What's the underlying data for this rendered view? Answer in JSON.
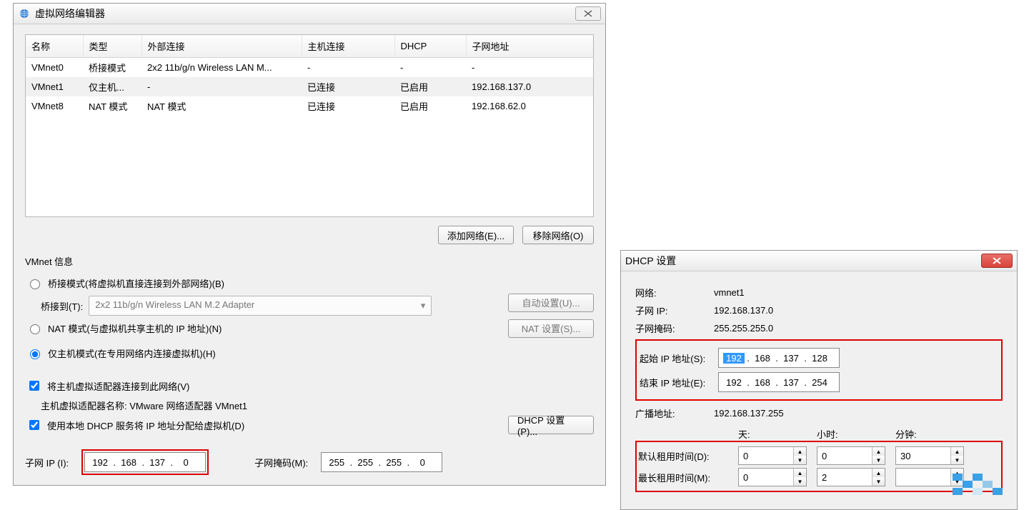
{
  "vnet_window": {
    "title": "虚拟网络编辑器",
    "table": {
      "headers": {
        "name": "名称",
        "type": "类型",
        "external": "外部连接",
        "host": "主机连接",
        "dhcp": "DHCP",
        "subnet": "子网地址"
      },
      "rows": [
        {
          "name": "VMnet0",
          "type": "桥接模式",
          "external": "2x2 11b/g/n Wireless LAN M...",
          "host": "-",
          "dhcp": "-",
          "subnet": "-",
          "selected": false
        },
        {
          "name": "VMnet1",
          "type": "仅主机...",
          "external": "-",
          "host": "已连接",
          "dhcp": "已启用",
          "subnet": "192.168.137.0",
          "selected": true
        },
        {
          "name": "VMnet8",
          "type": "NAT 模式",
          "external": "NAT 模式",
          "host": "已连接",
          "dhcp": "已启用",
          "subnet": "192.168.62.0",
          "selected": false
        }
      ]
    },
    "buttons": {
      "add": "添加网络(E)...",
      "remove": "移除网络(O)",
      "auto": "自动设置(U)...",
      "nat": "NAT 设置(S)...",
      "dhcp": "DHCP 设置(P)..."
    },
    "info_label": "VMnet 信息",
    "radios": {
      "bridge": "桥接模式(将虚拟机直接连接到外部网络)(B)",
      "bridge_to_label": "桥接到(T):",
      "bridge_to_value": "2x2 11b/g/n Wireless LAN M.2 Adapter",
      "nat": "NAT 模式(与虚拟机共享主机的 IP 地址)(N)",
      "hostonly": "仅主机模式(在专用网络内连接虚拟机)(H)"
    },
    "checks": {
      "connect_host": "将主机虚拟适配器连接到此网络(V)",
      "adapter_name": "主机虚拟适配器名称: VMware 网络适配器 VMnet1",
      "use_dhcp": "使用本地 DHCP 服务将 IP 地址分配给虚拟机(D)"
    },
    "subnet_row": {
      "ip_label": "子网 IP (I):",
      "ip_oct": [
        "192",
        "168",
        "137",
        "0"
      ],
      "mask_label": "子网掩码(M):",
      "mask_oct": [
        "255",
        "255",
        "255",
        "0"
      ]
    }
  },
  "dhcp_window": {
    "title": "DHCP 设置",
    "labels": {
      "network": "网络:",
      "subnet_ip": "子网 IP:",
      "subnet_mask": "子网掩码:",
      "start_ip": "起始 IP 地址(S):",
      "end_ip": "结束 IP 地址(E):",
      "broadcast": "广播地址:",
      "days": "天:",
      "hours": "小时:",
      "minutes": "分钟:",
      "default_lease": "默认租用时间(D):",
      "max_lease": "最长租用时间(M):"
    },
    "values": {
      "network": "vmnet1",
      "subnet_ip": "192.168.137.0",
      "subnet_mask": "255.255.255.0",
      "start_ip_oct": [
        "192",
        "168",
        "137",
        "128"
      ],
      "end_ip_oct": [
        "192",
        "168",
        "137",
        "254"
      ],
      "broadcast": "192.168.137.255",
      "default_lease": {
        "days": "0",
        "hours": "0",
        "minutes": "30"
      },
      "max_lease": {
        "days": "0",
        "hours": "2",
        "minutes": ""
      }
    }
  }
}
